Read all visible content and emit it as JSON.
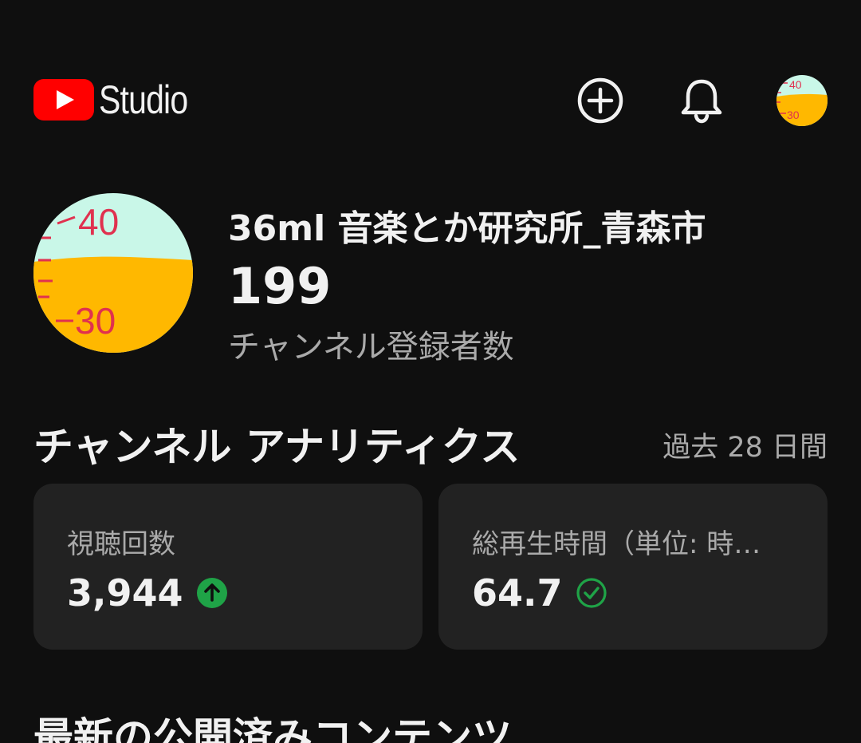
{
  "header": {
    "brand": "Studio",
    "icons": {
      "create": "create-plus-icon",
      "notifications": "bell-icon"
    },
    "avatar_marks": [
      "40",
      "30"
    ]
  },
  "colors": {
    "background": "#0f0f0f",
    "card": "#222222",
    "brand_red": "#ff0000",
    "positive_green": "#1fa347",
    "avatar_top": "#c9f7e8",
    "avatar_bottom": "#ffb800",
    "avatar_marks": "#e0314f"
  },
  "channel": {
    "name": "36ml 音楽とか研究所_青森市",
    "subscribers": "199",
    "subscribers_label": "チャンネル登録者数",
    "avatar_marks": [
      "40",
      "30"
    ]
  },
  "analytics": {
    "title": "チャンネル アナリティクス",
    "period": "過去 28 日間",
    "cards": [
      {
        "label": "視聴回数",
        "value": "3,944",
        "status_icon": "arrow-up-circle-icon"
      },
      {
        "label": "総再生時間（単位: 時…",
        "value": "64.7",
        "status_icon": "check-circle-icon"
      }
    ]
  },
  "latest": {
    "title": "最新の公開済みコンテンツ"
  }
}
